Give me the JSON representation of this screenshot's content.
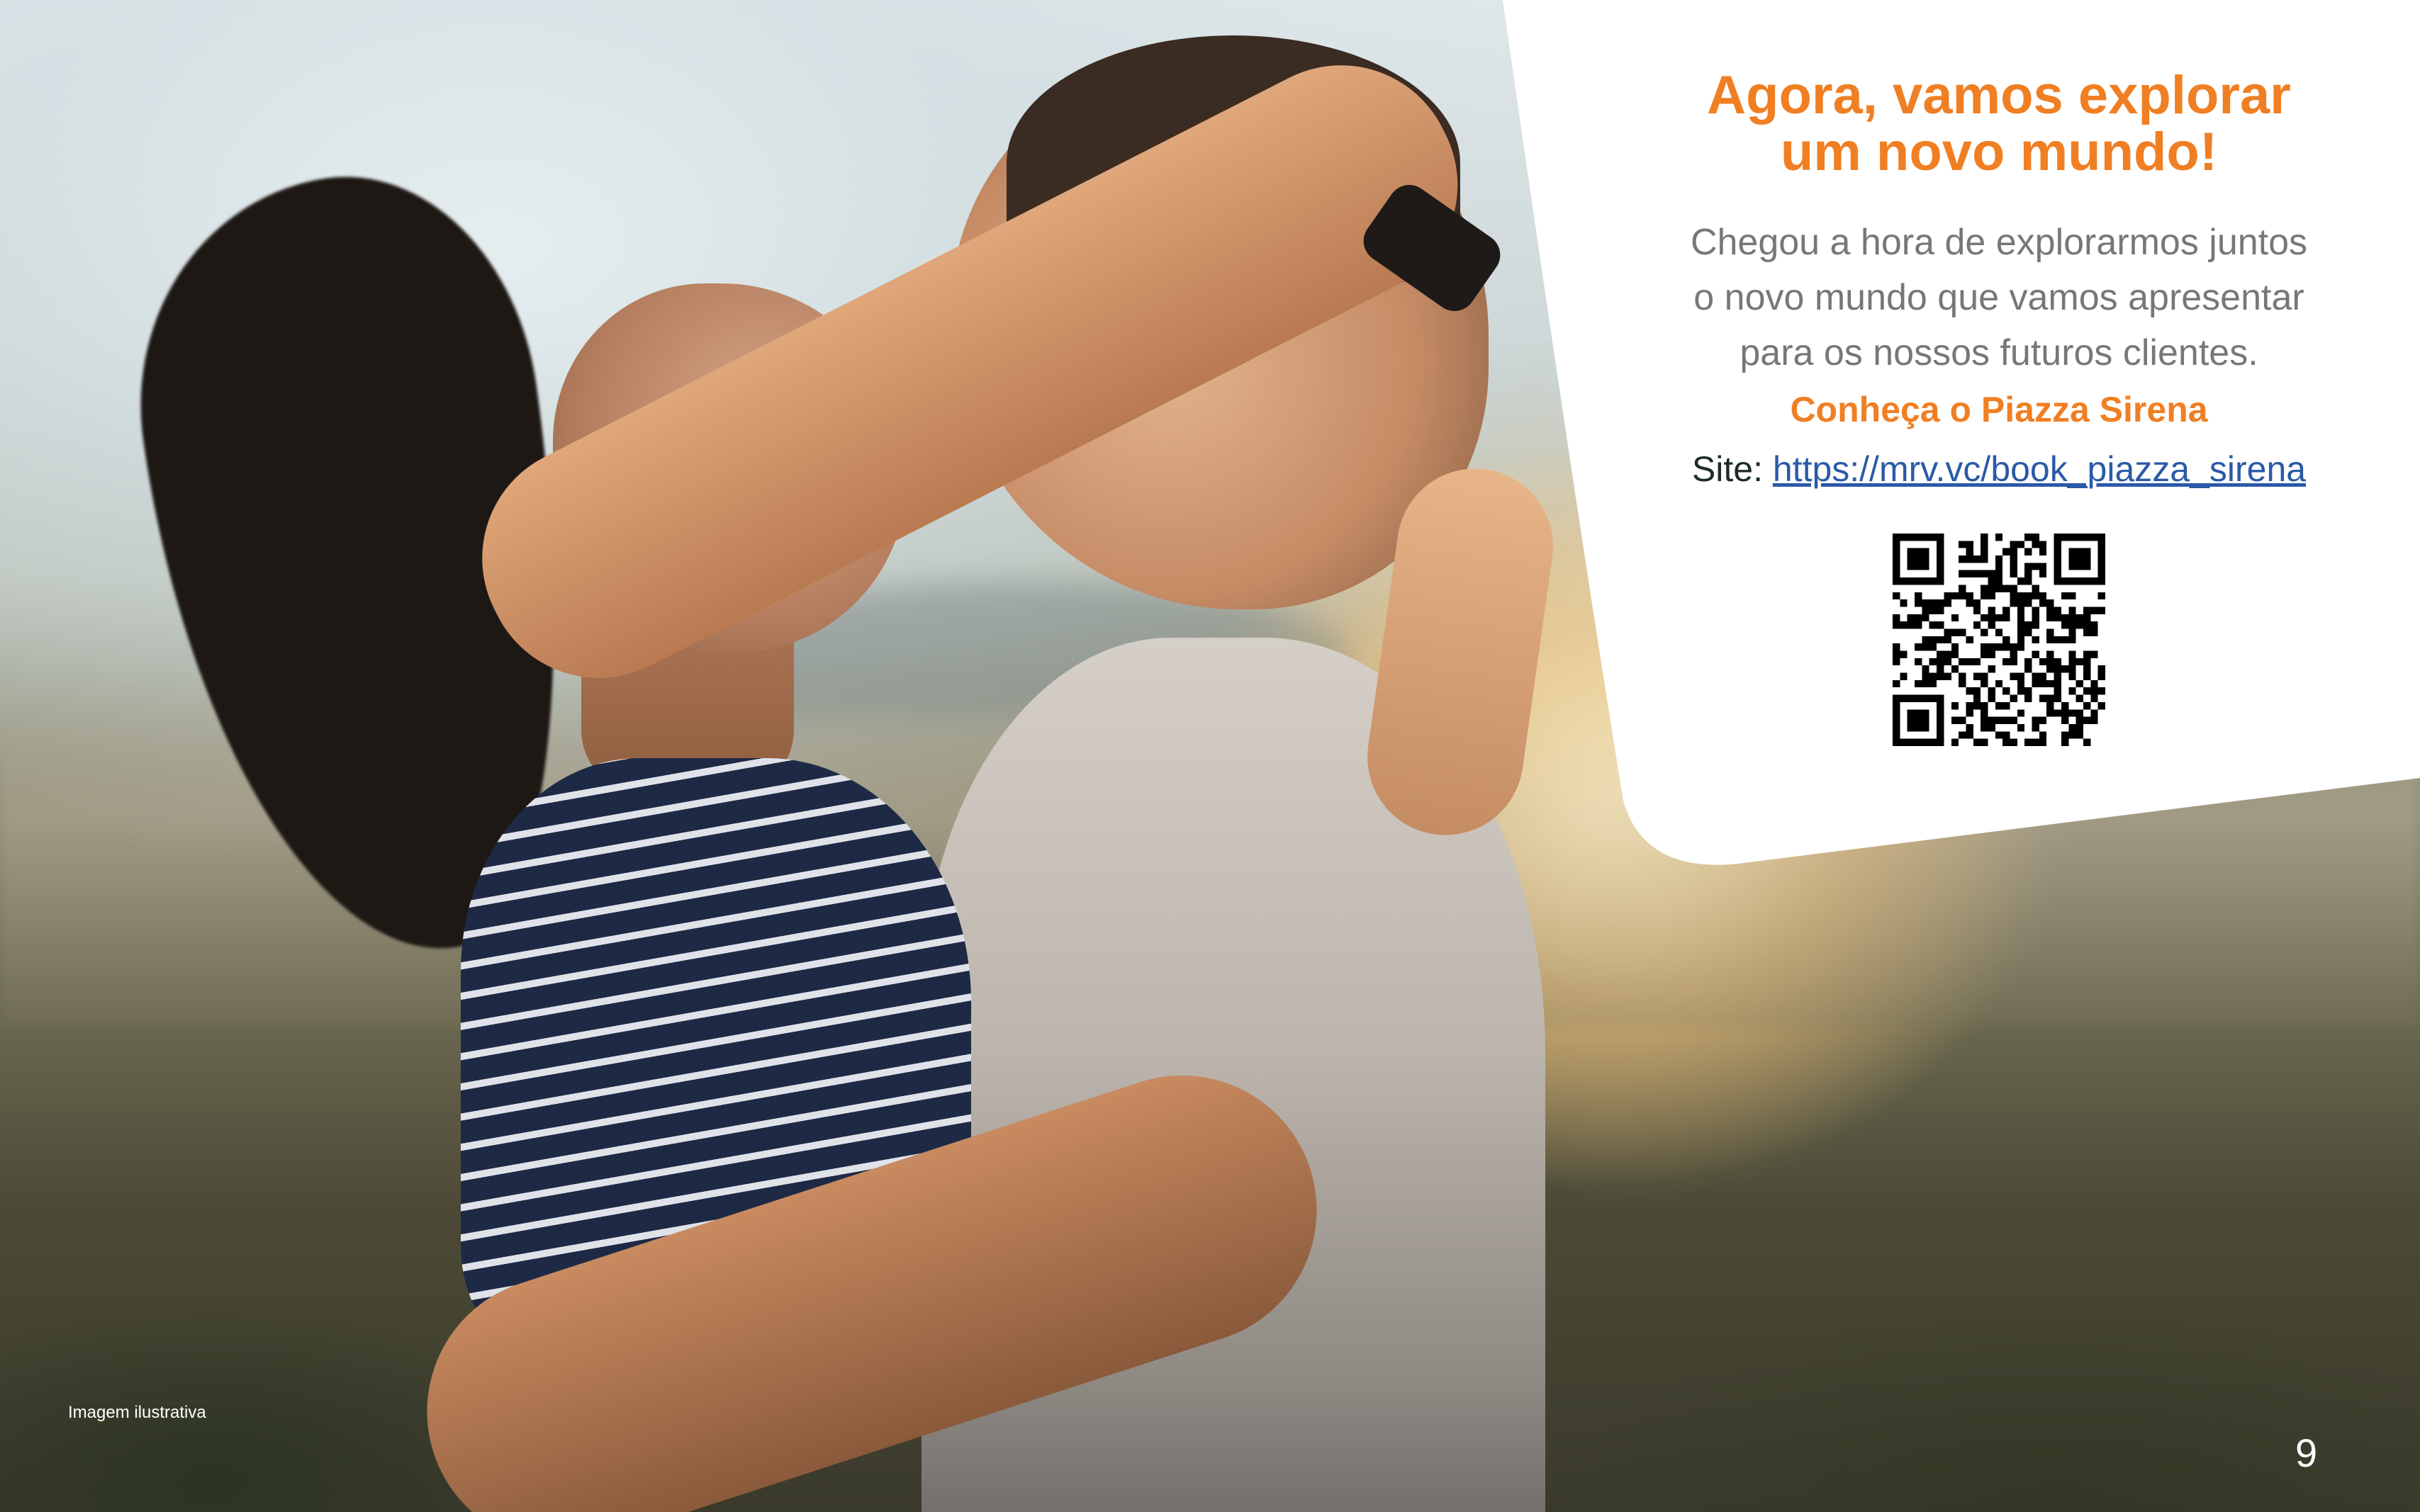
{
  "panel": {
    "title_line1": "Agora, vamos explorar",
    "title_line2": "um novo mundo!",
    "body_line1": "Chegou a hora de explorarmos juntos",
    "body_line2": "o novo mundo que vamos apresentar",
    "body_line3": "para os nossos futuros clientes.",
    "highlight": "Conheça o Piazza Sirena",
    "site_label": "Site:",
    "site_url": "https://mrv.vc/book_piazza_sirena",
    "qr_icon": "qr-code-icon"
  },
  "caption": "Imagem ilustrativa",
  "page_number": "9",
  "colors": {
    "accent_orange": "#f07f23",
    "body_gray": "#777777",
    "link_blue": "#2a5aa7"
  }
}
